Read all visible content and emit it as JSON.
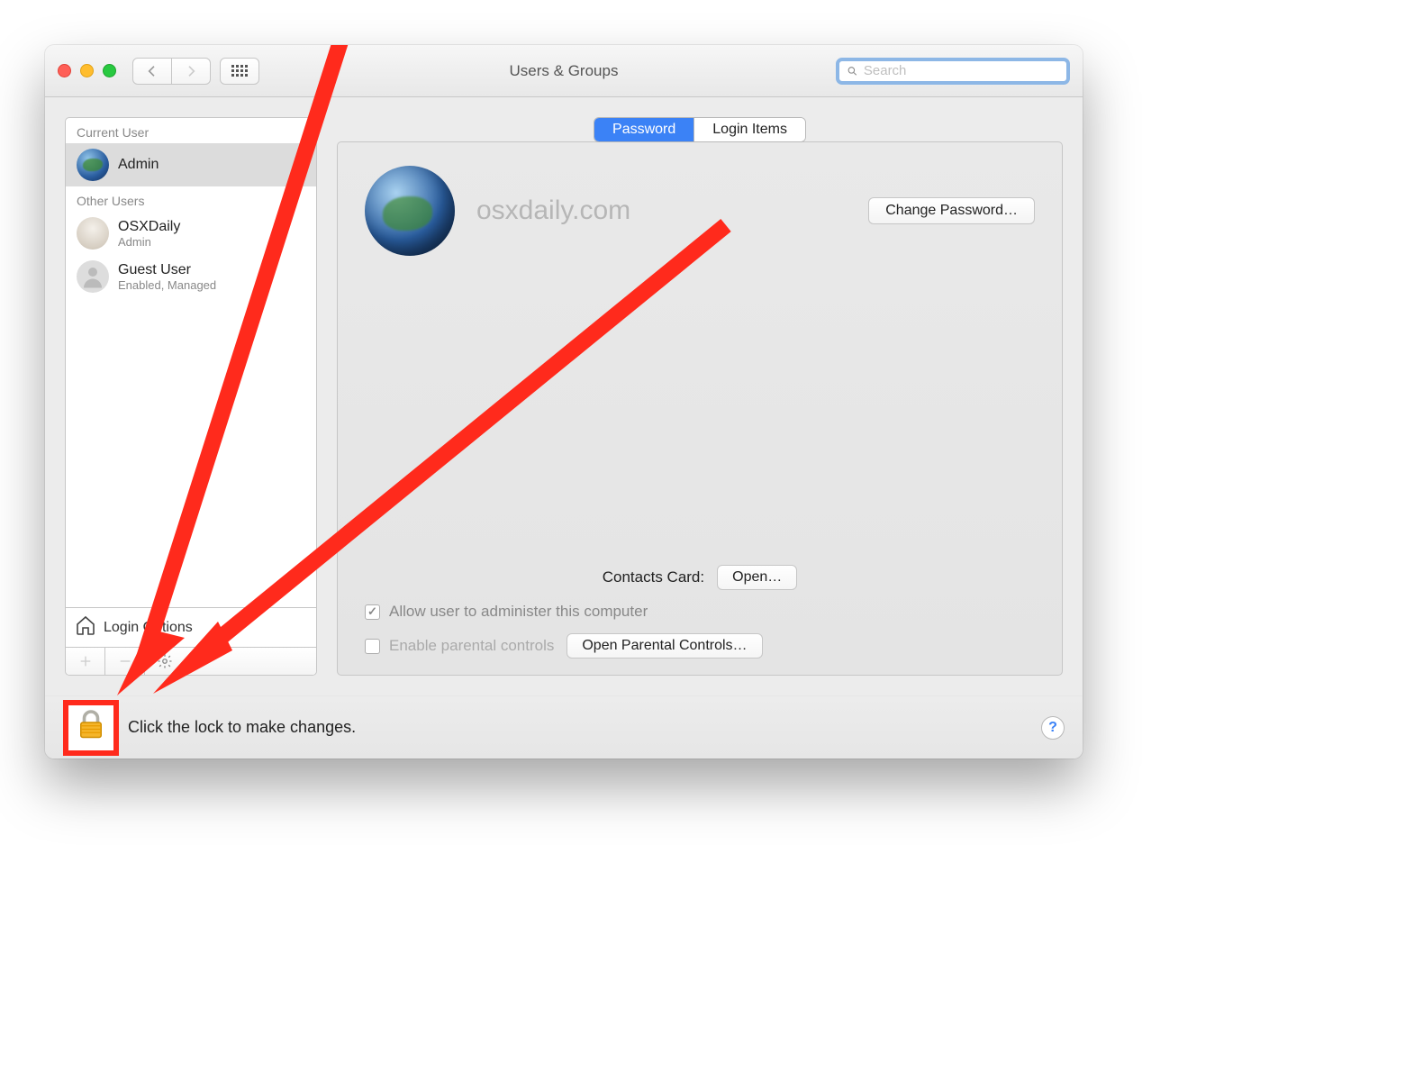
{
  "window": {
    "title": "Users & Groups",
    "search_placeholder": "Search"
  },
  "tabs": {
    "password": "Password",
    "login_items": "Login Items"
  },
  "sidebar": {
    "current_header": "Current User",
    "other_header": "Other Users",
    "current": {
      "name": "Admin"
    },
    "others": [
      {
        "name": "OSXDaily",
        "role": "Admin"
      },
      {
        "name": "Guest User",
        "role": "Enabled, Managed"
      }
    ],
    "login_options": "Login Options"
  },
  "main": {
    "watermark": "osxdaily.com",
    "change_password": "Change Password…",
    "contacts_label": "Contacts Card:",
    "open": "Open…",
    "allow_admin": "Allow user to administer this computer",
    "enable_parental": "Enable parental controls",
    "open_parental": "Open Parental Controls…"
  },
  "footer": {
    "lock_text": "Click the lock to make changes."
  }
}
